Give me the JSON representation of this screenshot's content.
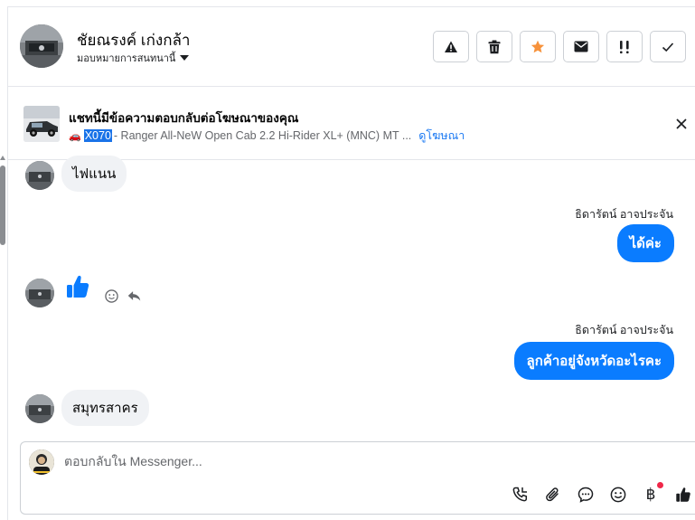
{
  "header": {
    "contact_name": "ชัยณรงค์ เก่งกล้า",
    "assign_label": "มอบหมายการสนทนานี้",
    "actions": [
      {
        "icon": "warning-icon"
      },
      {
        "icon": "trash-icon"
      },
      {
        "icon": "star-icon",
        "color": "#f7923b"
      },
      {
        "icon": "mail-icon"
      },
      {
        "icon": "follow-up-icon"
      },
      {
        "icon": "check-icon"
      }
    ]
  },
  "ad_banner": {
    "title": "แชทนี้มีข้อความตอบกลับต่อโฆษณาของคุณ",
    "car_icon": "🚗",
    "code": "X070",
    "description": " - Ranger All-NeW Open Cab 2.2 Hi-Rider XL+ (MNC) MT ...",
    "link": "ดูโฆษณา"
  },
  "messages": [
    {
      "direction": "in",
      "text": "ไฟแนน"
    },
    {
      "direction": "out",
      "sender": "ธิดารัตน์ อาจประจัน",
      "text": "ได้ค่ะ"
    },
    {
      "direction": "in",
      "type": "like"
    },
    {
      "direction": "out",
      "sender": "ธิดารัตน์ อาจประจัน",
      "text": "ลูกค้าอยู่จังหวัดอะไรคะ"
    },
    {
      "direction": "in",
      "text": "สมุทรสาคร"
    }
  ],
  "composer": {
    "placeholder": "ตอบกลับใน Messenger...",
    "tools": [
      "call-icon",
      "attach-icon",
      "saved-reply-icon",
      "emoji-icon",
      "baht-icon",
      "like-icon"
    ],
    "baht_symbol": "฿"
  },
  "colors": {
    "accent": "#0a7cff",
    "incoming_bubble": "#f0f2f5",
    "link": "#1877f2",
    "star": "#f7923b",
    "notification_dot": "#f02849"
  }
}
